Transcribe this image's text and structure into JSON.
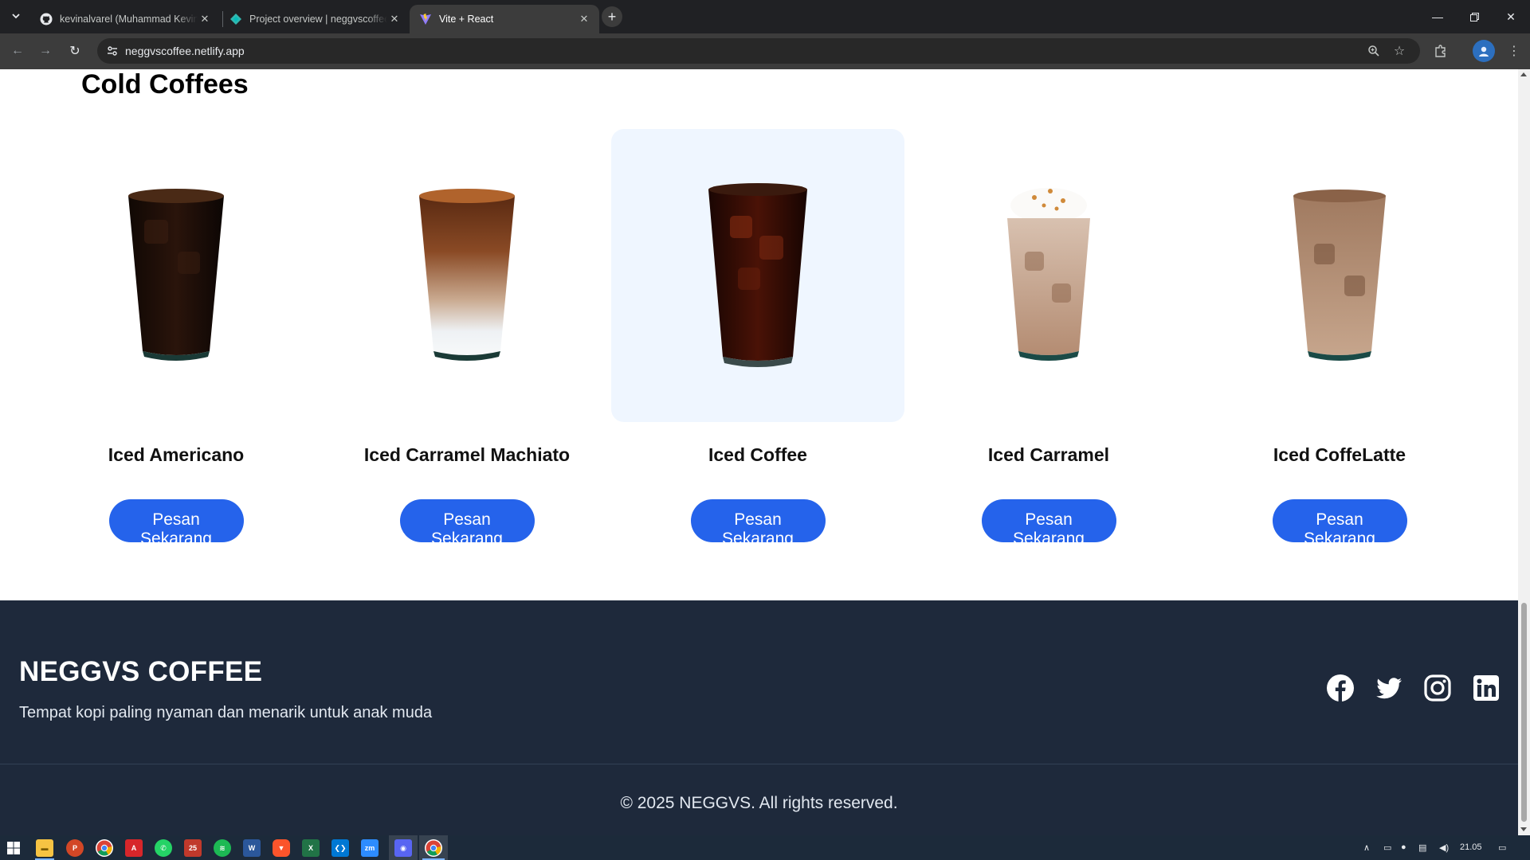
{
  "browser": {
    "tabs": [
      {
        "title": "kevinalvarel (Muhammad Kevin",
        "favicon": "github-icon",
        "active": false
      },
      {
        "title": "Project overview | neggvscoffee",
        "favicon": "netlify-icon",
        "active": false
      },
      {
        "title": "Vite + React",
        "favicon": "vite-icon",
        "active": true
      }
    ],
    "url": "neggvscoffee.netlify.app"
  },
  "page": {
    "section_title": "Cold Coffees",
    "products": [
      {
        "name": "Iced Americano",
        "button": "Pesan Sekarang",
        "drink": "americano"
      },
      {
        "name": "Iced Carramel Machiato",
        "button": "Pesan Sekarang",
        "drink": "macchiato"
      },
      {
        "name": "Iced Coffee",
        "button": "Pesan Sekarang",
        "drink": "coffee"
      },
      {
        "name": "Iced Carramel",
        "button": "Pesan Sekarang",
        "drink": "caramel"
      },
      {
        "name": "Iced CoffeLatte",
        "button": "Pesan Sekarang",
        "drink": "latte"
      }
    ]
  },
  "footer": {
    "brand": "NEGGVS COFFEE",
    "tagline": "Tempat kopi paling nyaman dan menarik untuk anak muda",
    "socials": [
      "facebook-icon",
      "twitter-icon",
      "instagram-icon",
      "linkedin-icon"
    ],
    "copyright": "© 2025 NEGGVS. All rights reserved."
  },
  "taskbar": {
    "clock": "21.05"
  },
  "colors": {
    "accent": "#2563eb",
    "footer_bg": "#1e293b",
    "card_hover_bg": "#eff6ff"
  }
}
